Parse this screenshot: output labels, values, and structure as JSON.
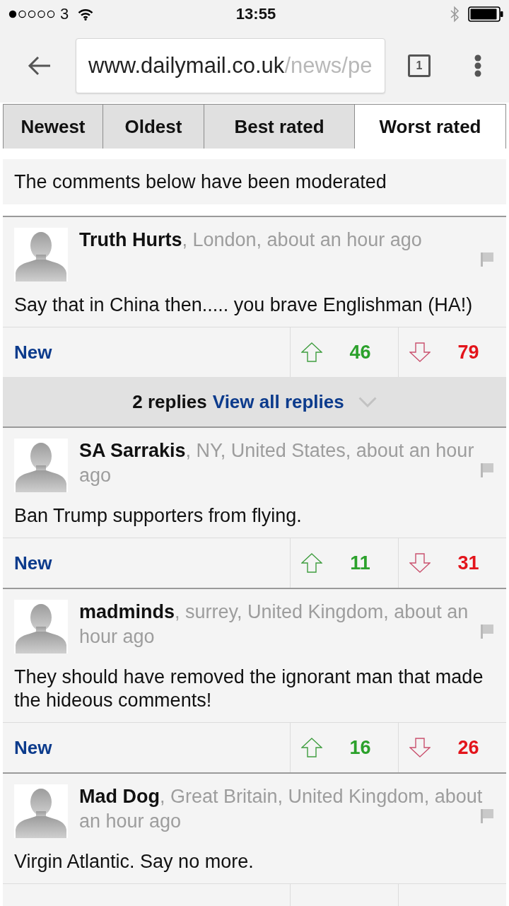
{
  "status_bar": {
    "carrier": "3",
    "time": "13:55"
  },
  "browser": {
    "url_host": "www.dailymail.co.uk",
    "url_path": "/news/pe",
    "tab_count": "1"
  },
  "sort_tabs": [
    {
      "label": "Newest",
      "selected": false
    },
    {
      "label": "Oldest",
      "selected": false
    },
    {
      "label": "Best rated",
      "selected": false
    },
    {
      "label": "Worst rated",
      "selected": true
    }
  ],
  "notice": "The comments below have been moderated",
  "comments": [
    {
      "author": "Truth Hurts",
      "location_time": ", London, about an hour ago",
      "body": "Say that in China then..... you brave Englishman (HA!)",
      "new_label": "New",
      "up_votes": "46",
      "down_votes": "79",
      "replies": {
        "count": "2 replies",
        "link": "View all replies"
      }
    },
    {
      "author": "SA Sarrakis",
      "location_time": ", NY, United States, about an hour ago",
      "body": "Ban Trump supporters from flying.",
      "new_label": "New",
      "up_votes": "11",
      "down_votes": "31"
    },
    {
      "author": "madminds",
      "location_time": ", surrey, United Kingdom, about an hour ago",
      "body": "They should have removed the ignorant man that made the hideous comments!",
      "new_label": "New",
      "up_votes": "16",
      "down_votes": "26"
    },
    {
      "author": "Mad Dog",
      "location_time": ", Great Britain, United Kingdom, about an hour ago",
      "body": "Virgin Atlantic. Say no more."
    }
  ]
}
